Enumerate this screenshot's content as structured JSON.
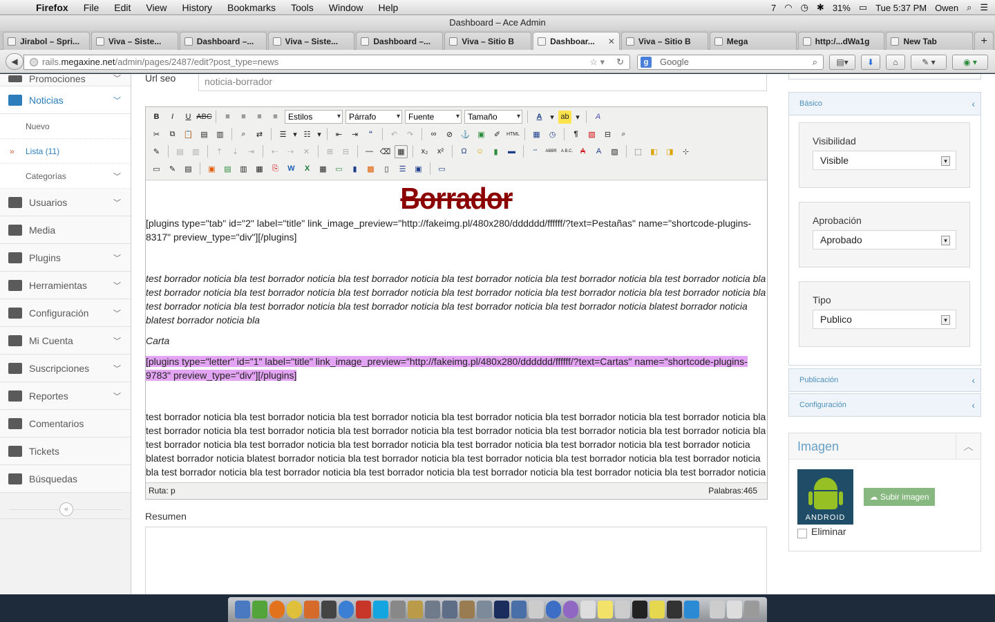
{
  "menubar": {
    "app": "Firefox",
    "items": [
      "File",
      "Edit",
      "View",
      "History",
      "Bookmarks",
      "Tools",
      "Window",
      "Help"
    ],
    "right": {
      "battery": "31%",
      "clock": "Tue 5:37 PM",
      "user": "Owen",
      "badge": "7"
    }
  },
  "window": {
    "title": "Dashboard – Ace Admin"
  },
  "tabs": [
    {
      "label": "Jirabol – Spri..."
    },
    {
      "label": "Viva – Siste..."
    },
    {
      "label": "Dashboard –..."
    },
    {
      "label": "Viva – Siste..."
    },
    {
      "label": "Dashboard –..."
    },
    {
      "label": "Viva – Sitio B"
    },
    {
      "label": "Dashboar...",
      "active": true
    },
    {
      "label": "Viva – Sitio B"
    },
    {
      "label": "Mega"
    },
    {
      "label": "http:/...dWa1g"
    },
    {
      "label": "New Tab"
    }
  ],
  "nav": {
    "url_prefix": "rails.",
    "url_domain": "megaxine.net",
    "url_path": "/admin/pages/2487/edit?post_type=news",
    "search_placeholder": "Google"
  },
  "sidebar": {
    "items": [
      {
        "label": "Promociones",
        "chevron": true
      },
      {
        "label": "Noticias",
        "chevron": true,
        "open": true
      },
      {
        "label": "Usuarios",
        "chevron": true
      },
      {
        "label": "Media",
        "chevron": false
      },
      {
        "label": "Plugins",
        "chevron": true
      },
      {
        "label": "Herramientas",
        "chevron": true
      },
      {
        "label": "Configuración",
        "chevron": true
      },
      {
        "label": "Mi Cuenta",
        "chevron": true
      },
      {
        "label": "Suscripciones",
        "chevron": true
      },
      {
        "label": "Reportes",
        "chevron": true
      },
      {
        "label": "Comentarios",
        "chevron": false
      },
      {
        "label": "Tickets",
        "chevron": false
      },
      {
        "label": "Búsquedas",
        "chevron": false
      }
    ],
    "sub": [
      {
        "label": "Nuevo"
      },
      {
        "label": "Lista (11)",
        "active": true
      },
      {
        "label": "Categorías",
        "chevron": true
      }
    ]
  },
  "form": {
    "urlseo_label": "Url seo",
    "urlseo_value": "noticia-borrador",
    "resumen_label": "Resumen"
  },
  "editor": {
    "dropdowns": {
      "styles": "Estilos",
      "format": "Párrafo",
      "font": "Fuente",
      "size": "Tamaño"
    },
    "heading": "Borrador",
    "p1": "[plugins type=\"tab\" id=\"2\" label=\"title\" link_image_preview=\"http://fakeimg.pl/480x280/dddddd/ffffff/?text=Pestañas\" name=\"shortcode-plugins-8317\" preview_type=\"div\"][/plugins]",
    "p2": "test borrador noticia bla test borrador noticia bla test borrador noticia bla test borrador noticia bla test borrador noticia bla test borrador noticia bla test borrador noticia bla test borrador noticia bla test borrador noticia bla test borrador noticia bla test borrador noticia bla test borrador noticia bla test borrador noticia bla test borrador noticia bla test borrador noticia bla test borrador noticia bla test borrador noticia blatest borrador noticia blatest borrador noticia bla",
    "p3": "Carta",
    "p4": "[plugins type=\"letter\" id=\"1\" label=\"title\" link_image_preview=\"http://fakeimg.pl/480x280/dddddd/ffffff/?text=Cartas\" name=\"shortcode-plugins-9783\" preview_type=\"div\"][/plugins]",
    "p5": "test borrador noticia bla test borrador noticia bla test borrador noticia bla test borrador noticia bla test borrador noticia bla test borrador noticia bla test borrador noticia bla test borrador noticia bla test borrador noticia bla test borrador noticia bla test borrador noticia bla test borrador noticia bla test borrador noticia bla test borrador noticia bla test borrador noticia bla test borrador noticia bla test borrador noticia bla test borrador noticia blatest borrador noticia blatest borrador noticia bla test borrador noticia bla test borrador noticia bla test borrador noticia bla test borrador noticia bla test borrador noticia bla test borrador noticia bla test borrador noticia bla test borrador noticia bla test borrador noticia bla test borrador noticia bla test borrador",
    "path": "Ruta: p",
    "words": "Palabras:465"
  },
  "right": {
    "basico": "Básico",
    "visibilidad_label": "Visibilidad",
    "visibilidad_value": "Visible",
    "aprobacion_label": "Aprobación",
    "aprobacion_value": "Aprobado",
    "tipo_label": "Tipo",
    "tipo_value": "Publico",
    "publicacion": "Publicación",
    "configuracion": "Configuración",
    "imagen_title": "Imagen",
    "android_text": "ANDROID",
    "upload_label": "Subir imagen",
    "eliminar_label": "Eliminar"
  },
  "colors": {
    "accent": "#2b7dbc",
    "heading": "#8b0000",
    "highlight": "#e3a4f3",
    "upload": "#87b87f"
  }
}
